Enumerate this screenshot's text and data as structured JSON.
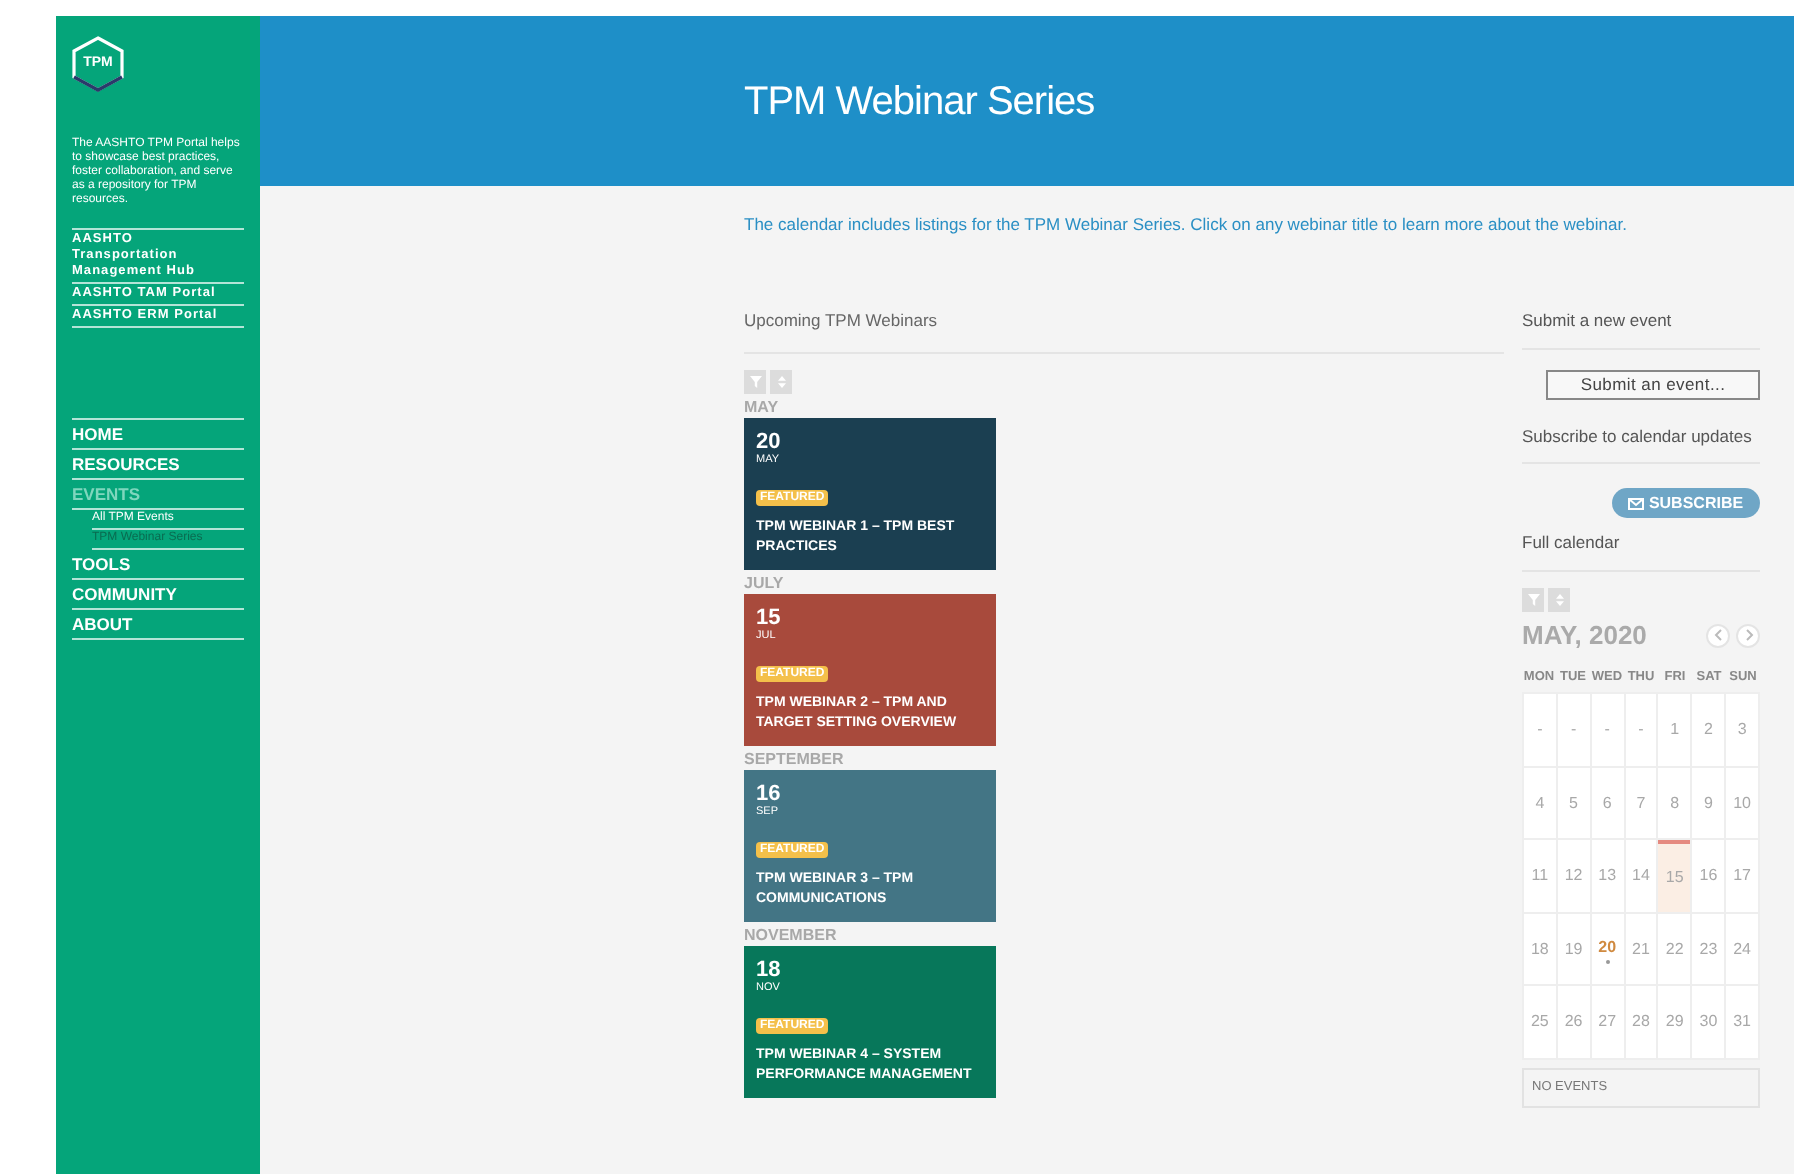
{
  "sidebar": {
    "logo": "TPM",
    "about": "The AASHTO TPM Portal helps to showcase best practices, foster collaboration, and serve as a repository for TPM resources.",
    "portal_links": [
      "AASHTO Transportation Management Hub",
      "AASHTO TAM Portal",
      "AASHTO ERM Portal"
    ],
    "nav": [
      {
        "label": "HOME",
        "selected": false
      },
      {
        "label": "RESOURCES",
        "selected": false
      },
      {
        "label": "EVENTS",
        "selected": true,
        "children": [
          {
            "label": "All TPM Events",
            "selected": false
          },
          {
            "label": "TPM Webinar Series",
            "selected": true
          }
        ]
      },
      {
        "label": "TOOLS",
        "selected": false
      },
      {
        "label": "COMMUNITY",
        "selected": false
      },
      {
        "label": "ABOUT",
        "selected": false
      }
    ]
  },
  "header": {
    "title": "TPM Webinar Series"
  },
  "intro": "The calendar includes listings for the TPM Webinar Series. Click on any webinar title to learn more about the webinar.",
  "events_list": {
    "heading": "Upcoming TPM Webinars",
    "groups": [
      {
        "month": "MAY",
        "events": [
          {
            "day": "20",
            "month": "MAY",
            "badge": "FEATURED",
            "title": "TPM WEBINAR 1 – TPM BEST PRACTICES",
            "color": "#1b3f51"
          }
        ]
      },
      {
        "month": "JULY",
        "events": [
          {
            "day": "15",
            "month": "JUL",
            "badge": "FEATURED",
            "title": "TPM WEBINAR 2 – TPM AND TARGET SETTING OVERVIEW",
            "color": "#a84a3c"
          }
        ]
      },
      {
        "month": "SEPTEMBER",
        "events": [
          {
            "day": "16",
            "month": "SEP",
            "badge": "FEATURED",
            "title": "TPM WEBINAR 3 – TPM COMMUNICATIONS",
            "color": "#437585"
          }
        ]
      },
      {
        "month": "NOVEMBER",
        "events": [
          {
            "day": "18",
            "month": "NOV",
            "badge": "FEATURED",
            "title": "TPM WEBINAR 4 – SYSTEM PERFORMANCE MANAGEMENT",
            "color": "#07775a"
          }
        ]
      }
    ]
  },
  "aside": {
    "submit_heading": "Submit a new event",
    "submit_button": "Submit an event...",
    "subscribe_heading": "Subscribe to calendar updates",
    "subscribe_button": "SUBSCRIBE",
    "calendar_heading": "Full calendar"
  },
  "calendar": {
    "title": "MAY, 2020",
    "weekdays": [
      "MON",
      "TUE",
      "WED",
      "THU",
      "FRI",
      "SAT",
      "SUN"
    ],
    "days": [
      {
        "label": "-",
        "today": false,
        "event": false
      },
      {
        "label": "-",
        "today": false,
        "event": false
      },
      {
        "label": "-",
        "today": false,
        "event": false
      },
      {
        "label": "-",
        "today": false,
        "event": false
      },
      {
        "label": "1",
        "today": false,
        "event": false
      },
      {
        "label": "2",
        "today": false,
        "event": false
      },
      {
        "label": "3",
        "today": false,
        "event": false
      },
      {
        "label": "4",
        "today": false,
        "event": false
      },
      {
        "label": "5",
        "today": false,
        "event": false
      },
      {
        "label": "6",
        "today": false,
        "event": false
      },
      {
        "label": "7",
        "today": false,
        "event": false
      },
      {
        "label": "8",
        "today": false,
        "event": false
      },
      {
        "label": "9",
        "today": false,
        "event": false
      },
      {
        "label": "10",
        "today": false,
        "event": false
      },
      {
        "label": "11",
        "today": false,
        "event": false
      },
      {
        "label": "12",
        "today": false,
        "event": false
      },
      {
        "label": "13",
        "today": false,
        "event": false
      },
      {
        "label": "14",
        "today": false,
        "event": false
      },
      {
        "label": "15",
        "today": true,
        "event": false
      },
      {
        "label": "16",
        "today": false,
        "event": false
      },
      {
        "label": "17",
        "today": false,
        "event": false
      },
      {
        "label": "18",
        "today": false,
        "event": false
      },
      {
        "label": "19",
        "today": false,
        "event": false
      },
      {
        "label": "20",
        "today": false,
        "event": true
      },
      {
        "label": "21",
        "today": false,
        "event": false
      },
      {
        "label": "22",
        "today": false,
        "event": false
      },
      {
        "label": "23",
        "today": false,
        "event": false
      },
      {
        "label": "24",
        "today": false,
        "event": false
      },
      {
        "label": "25",
        "today": false,
        "event": false
      },
      {
        "label": "26",
        "today": false,
        "event": false
      },
      {
        "label": "27",
        "today": false,
        "event": false
      },
      {
        "label": "28",
        "today": false,
        "event": false
      },
      {
        "label": "29",
        "today": false,
        "event": false
      },
      {
        "label": "30",
        "today": false,
        "event": false
      },
      {
        "label": "31",
        "today": false,
        "event": false
      }
    ],
    "empty_note": "NO EVENTS"
  }
}
